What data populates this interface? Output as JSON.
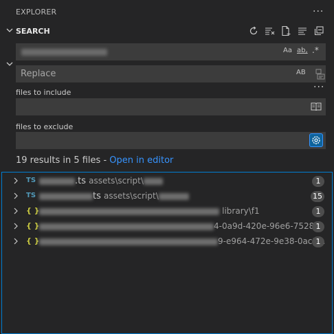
{
  "explorer": {
    "title": "EXPLORER",
    "more": "···"
  },
  "search": {
    "title": "SEARCH",
    "query_value": "",
    "match_case": "Aa",
    "whole_word": "ab",
    "regex": ".*",
    "replace_placeholder": "Replace",
    "preserve_case": "AB",
    "more": "···",
    "include_label": "files to include",
    "exclude_label": "files to exclude",
    "summary_text": "19 results in 5 files - ",
    "open_in_editor": "Open in editor"
  },
  "results": [
    {
      "type": "TS",
      "name_suffix": ".ts",
      "path": "assets\\script\\",
      "count": "1"
    },
    {
      "type": "TS",
      "name_suffix": "ts",
      "path": "assets\\script\\",
      "count": "15"
    },
    {
      "type": "{ }",
      "name_suffix": "",
      "path": "library\\f1",
      "count": "1"
    },
    {
      "type": "{ }",
      "name_suffix": "",
      "path": "4-0a9d-420e-96e6-7528...",
      "count": "1"
    },
    {
      "type": "{ }",
      "name_suffix": "",
      "path": "9-e964-472e-9e38-0ac1...",
      "count": "1"
    }
  ]
}
